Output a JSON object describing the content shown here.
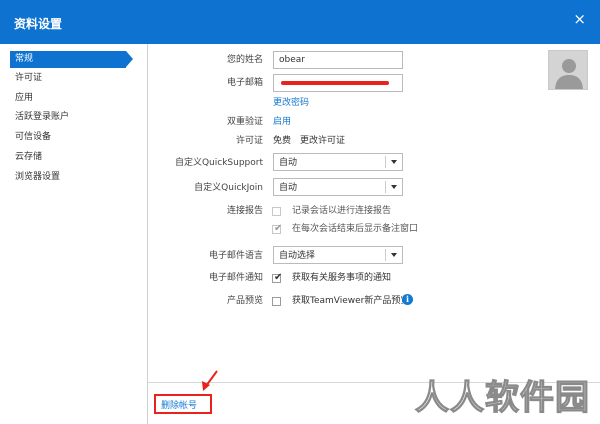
{
  "window": {
    "title": "资料设置",
    "close_glyph": "×"
  },
  "sidebar": {
    "items": [
      {
        "label": "常规",
        "active": true
      },
      {
        "label": "许可证"
      },
      {
        "label": "应用"
      },
      {
        "label": "活跃登录账户"
      },
      {
        "label": "可信设备"
      },
      {
        "label": "云存储"
      },
      {
        "label": "浏览器设置"
      }
    ]
  },
  "form": {
    "name": {
      "label": "您的姓名",
      "value": "obear"
    },
    "email": {
      "label": "电子邮箱",
      "value": ""
    },
    "change_password": "更改密码",
    "two_factor": {
      "label": "双重验证",
      "link": "启用"
    },
    "license": {
      "label": "许可证",
      "value": "免费",
      "link": "更改许可证"
    },
    "quicksupport": {
      "label": "自定义QuickSupport",
      "value": "自动"
    },
    "quickjoin": {
      "label": "自定义QuickJoin",
      "value": "自动"
    },
    "connection_report": {
      "label": "连接报告",
      "options": [
        {
          "text": "记录会话以进行连接报告",
          "checked": false
        },
        {
          "text": "在每次会话结束后显示备注窗口",
          "checked": true
        }
      ]
    },
    "email_language": {
      "label": "电子邮件语言",
      "value": "自动选择"
    },
    "email_notify": {
      "label": "电子邮件通知",
      "text": "获取有关服务事项的通知",
      "checked": true
    },
    "preview": {
      "label": "产品预览",
      "text": "获取TeamViewer新产品预览",
      "checked": false,
      "info_glyph": "i"
    }
  },
  "footer": {
    "delete_account": "删除帐号"
  },
  "watermark": "人人软件园",
  "colors": {
    "accent": "#0e73d0",
    "link": "#1479d1",
    "annotation": "#e8221d"
  },
  "icons": {
    "close": "close-icon",
    "avatar": "user-avatar-icon",
    "info": "info-icon",
    "dropdown": "chevron-down-icon",
    "check": "checkmark-icon"
  }
}
